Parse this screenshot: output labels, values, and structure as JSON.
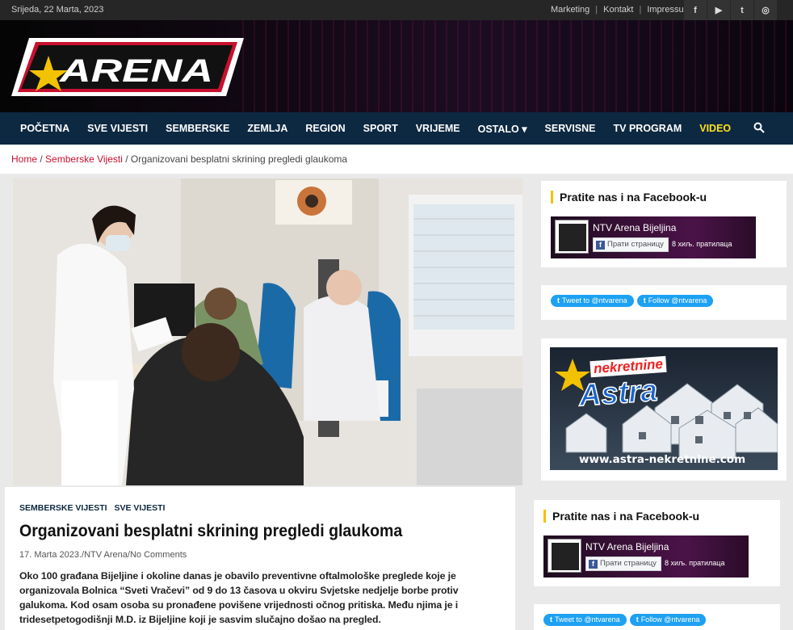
{
  "topbar": {
    "date": "Srijeda, 22 Marta, 2023",
    "links": [
      "Marketing",
      "Kontakt",
      "Impressum"
    ],
    "social": [
      "facebook-icon",
      "youtube-icon",
      "twitter-icon",
      "instagram-icon"
    ],
    "social_glyphs": [
      "f",
      "▶",
      "t",
      "◎"
    ],
    "sep": "|"
  },
  "logo": {
    "text": "ARENA"
  },
  "nav": {
    "items": [
      "POČETNA",
      "SVE VIJESTI",
      "SEMBERSKE",
      "ZEMLJA",
      "REGION",
      "SPORT",
      "VRIJEME",
      "OSTALO ▾",
      "SERVISNE",
      "TV PROGRAM",
      "VIDEO"
    ],
    "highlight_color": "#ffe21a"
  },
  "breadcrumb": {
    "home": "Home",
    "section": "Semberske Vijesti",
    "current": "Organizovani besplatni skrining pregledi glaukoma",
    "sep": "/"
  },
  "article": {
    "categories": [
      "SEMBERSKE VIJESTI",
      "SVE VIJESTI"
    ],
    "title": "Organizovani besplatni skrining pregledi glaukoma",
    "meta": "17. Marta 2023./NTV Arena/No Comments",
    "body": "Oko 100 građana Bijeljine i okoline danas je obavilo preventivne oftalmološke preglede koje je organizovala Bolnica “Sveti Vračevi” od 9 do 13 časova u okviru Svjetske nedjelje borbe protiv galukoma. Kod osam osoba su pronađene povišene vrijednosti očnog pritiska. Među njima je i tridesetpetogodišnji M.D. iz Bijeljine koji je sasvim slučajno došao na pregled."
  },
  "sidebar": {
    "facebook_title": "Pratite nas i na Facebook-u",
    "fb_page_name": "NTV Arena Bijeljina",
    "fb_follow": "Прати страницу",
    "fb_count": "8 хиљ. пратилаца",
    "tweet_btn": "Tweet to @ntvarena",
    "follow_btn": "Follow @ntvarena",
    "ad_brand_top": "nekretnine",
    "ad_brand_main": "Astra",
    "ad_url": "www.astra-nekretnine.com"
  }
}
